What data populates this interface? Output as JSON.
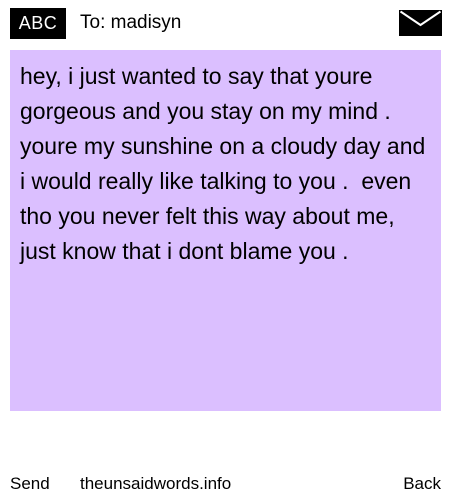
{
  "header": {
    "input_mode": "ABC",
    "to_label": "To: madisyn",
    "envelope_icon": "envelope-icon"
  },
  "message": {
    "text": "hey, i just wanted to say that youre gorgeous and you stay on my mind . youre my sunshine on a cloudy day and i would really like talking to you .  even tho you never felt this way about me, just know that i dont blame you .",
    "background_color": "#dbbfff"
  },
  "footer": {
    "send_label": "Send",
    "site_label": "theunsaidwords.info",
    "back_label": "Back"
  }
}
